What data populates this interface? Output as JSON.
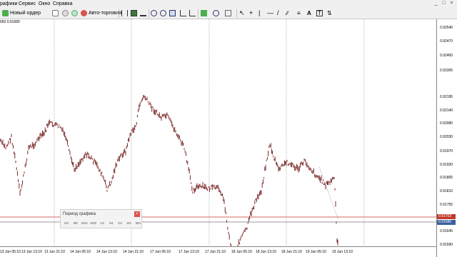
{
  "menu": {
    "items": [
      "рафики",
      "Сервис",
      "Окно",
      "Справка"
    ],
    "window_controls": [
      "_",
      "□",
      "×"
    ]
  },
  "toolbar": {
    "new_order_label": "Новый ордер",
    "autotrading_label": "Авто-торговля",
    "icons": [
      "new-chart-icon",
      "history-icon",
      "strategy-tester-icon",
      "new-order-icon",
      "metaeditor-icon",
      "autotrading-icon",
      "bar-chart-icon",
      "candlestick-icon",
      "line-chart-icon",
      "zoom-in-icon",
      "zoom-out-icon",
      "tile-windows-icon",
      "autoscroll-icon",
      "chart-shift-icon",
      "indicators-icon",
      "periods-icon",
      "templates-icon",
      "cursor-icon",
      "crosshair-icon",
      "vertical-line-icon",
      "horizontal-line-icon",
      "trendline-icon",
      "channel-icon",
      "fibonacci-icon",
      "text-icon",
      "label-icon",
      "arrows-icon"
    ]
  },
  "chart": {
    "symbol_label": "650 0.91680",
    "price_labels": [
      "0.92540",
      "0.92470",
      "0.92400",
      "0.92305",
      "0.92195",
      "0.92140",
      "0.92080",
      "0.92030",
      "0.91970",
      "0.91920",
      "0.91865",
      "0.91810",
      "0.91755",
      "0.91700",
      "0.91645",
      "0.91590"
    ],
    "time_labels": [
      "13 Jun 05:10",
      "13 Jun 13:10",
      "13 Jun 21:10",
      "14 Jun 05:10",
      "14 Jun 13:10",
      "14 Jun 21:10",
      "17 Jun 05:10",
      "17 Jun 13:10",
      "17 Jun 21:10",
      "18 Jun 05:10",
      "18 Jun 13:10",
      "18 Jun 21:10",
      "19 Jun 05:10",
      "19 Jun 13:10"
    ],
    "ask_tag": "0.91703",
    "bid_tag": "0.91680",
    "colors": {
      "candle": "#6b0f0f",
      "ask_line": "#c0392b",
      "bid_line": "#7a7a7a",
      "grid": "#8a8a8a",
      "tag_ask": "#c0392b",
      "tag_bid": "#3a5fa0"
    }
  },
  "period_panel": {
    "title": "Период графика",
    "buttons": [
      "M1",
      "M5",
      "M15",
      "M30",
      "H1",
      "H4",
      "D1",
      "W1",
      "MN"
    ]
  }
}
